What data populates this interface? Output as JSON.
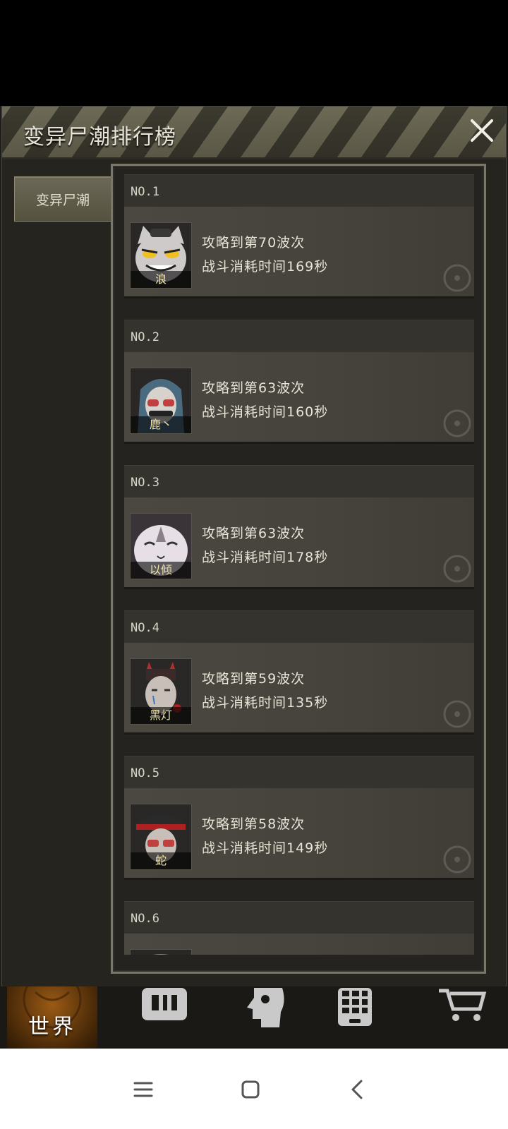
{
  "dialog": {
    "title": "变异尸潮排行榜",
    "close_icon": "close-icon"
  },
  "tabs": [
    {
      "label": "变异尸潮",
      "active": true
    }
  ],
  "rankings": [
    {
      "rank": "NO.1",
      "name": "浪",
      "line1": "攻略到第70波次",
      "line2": "战斗消耗时间169秒"
    },
    {
      "rank": "NO.2",
      "name": "鹿丶",
      "line1": "攻略到第63波次",
      "line2": "战斗消耗时间160秒"
    },
    {
      "rank": "NO.3",
      "name": "以倾",
      "line1": "攻略到第63波次",
      "line2": "战斗消耗时间178秒"
    },
    {
      "rank": "NO.4",
      "name": "黑灯",
      "line1": "攻略到第59波次",
      "line2": "战斗消耗时间135秒"
    },
    {
      "rank": "NO.5",
      "name": "蛇",
      "line1": "攻略到第58波次",
      "line2": "战斗消耗时间149秒"
    },
    {
      "rank": "NO.6",
      "name": "",
      "line1": "",
      "line2": ""
    }
  ],
  "game_nav": {
    "world_label": "世界",
    "items": [
      "backpack-icon",
      "head-icon",
      "phone-icon",
      "cart-icon"
    ]
  },
  "system_nav": {
    "items": [
      "menu-icon",
      "home-icon",
      "back-icon"
    ]
  }
}
